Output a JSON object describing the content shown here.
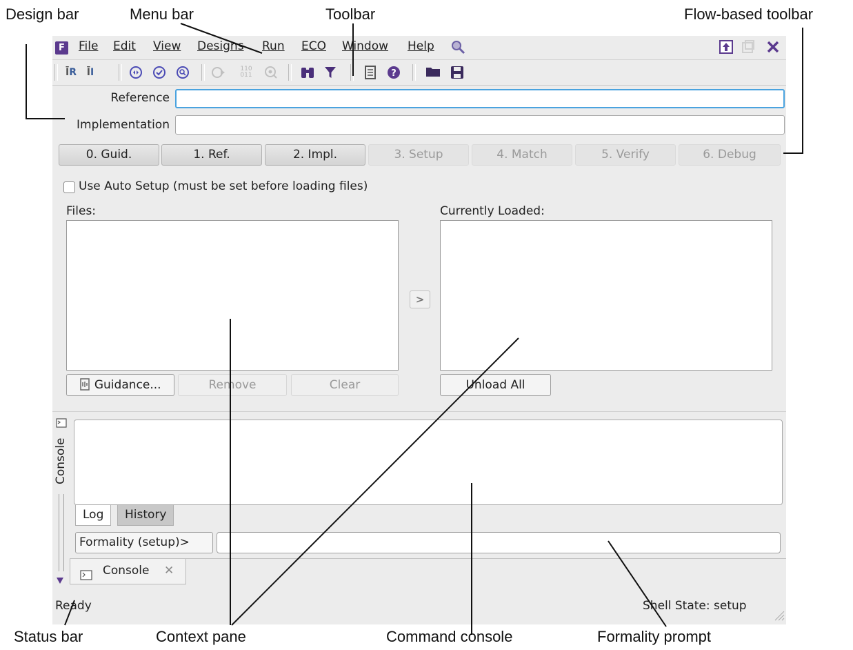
{
  "callouts": {
    "design_bar": "Design bar",
    "menu_bar": "Menu bar",
    "toolbar": "Toolbar",
    "flow_toolbar": "Flow-based toolbar",
    "status_bar": "Status bar",
    "context_pane": "Context pane",
    "command_console": "Command console",
    "formality_prompt": "Formality prompt"
  },
  "app": {
    "logo_letter": "F"
  },
  "menus": [
    "File",
    "Edit",
    "View",
    "Designs",
    "Run",
    "ECO",
    "Window",
    "Help"
  ],
  "design_bar": {
    "reference_label": "Reference",
    "reference_value": "",
    "implementation_label": "Implementation",
    "implementation_value": ""
  },
  "flow_steps": [
    {
      "label": "0. Guid.",
      "enabled": true
    },
    {
      "label": "1. Ref.",
      "enabled": true
    },
    {
      "label": "2. Impl.",
      "enabled": true
    },
    {
      "label": "3. Setup",
      "enabled": false
    },
    {
      "label": "4. Match",
      "enabled": false
    },
    {
      "label": "5. Verify",
      "enabled": false
    },
    {
      "label": "6. Debug",
      "enabled": false
    }
  ],
  "setup": {
    "auto_setup_label": "Use Auto Setup (must be set before loading files)",
    "auto_setup_checked": false,
    "files_label": "Files:",
    "loaded_label": "Currently Loaded:",
    "guidance_button": "Guidance...",
    "remove_button": "Remove",
    "clear_button": "Clear",
    "unload_button": "Unload All"
  },
  "console": {
    "side_label": "Console",
    "tabs": [
      "Log",
      "History"
    ],
    "active_tab": "Log",
    "prompt": "Formality (setup)>",
    "input_value": "",
    "bottom_tab": "Console"
  },
  "status": {
    "left": "Ready",
    "right": "Shell State: setup"
  },
  "colors": {
    "logo": "#5b3a8e",
    "focus": "#4aa3df",
    "window_bg": "#ececec"
  }
}
